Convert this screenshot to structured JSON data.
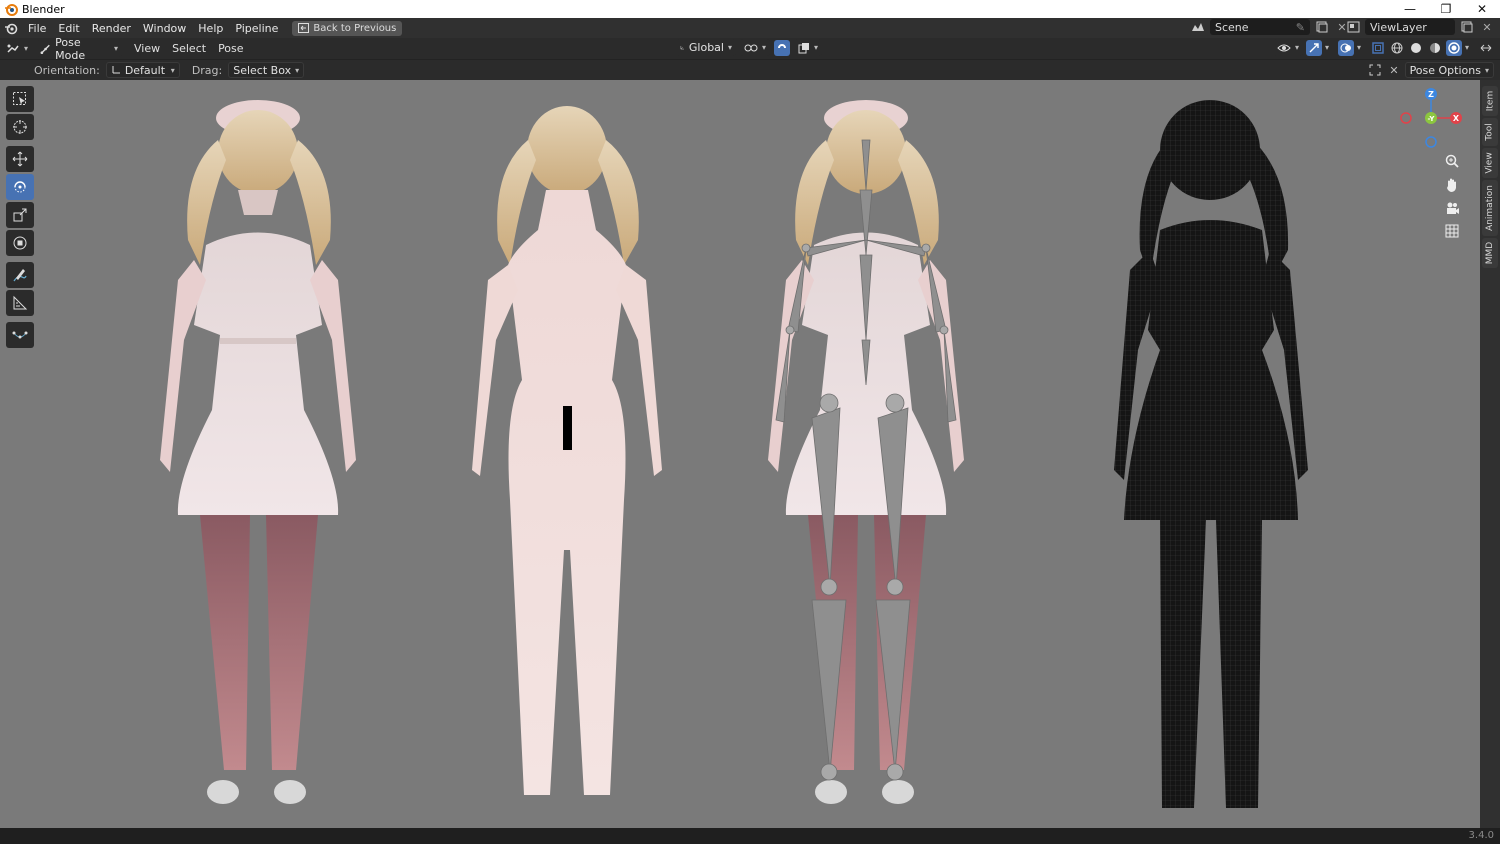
{
  "window": {
    "title": "Blender",
    "controls": [
      "minimize",
      "restore",
      "close"
    ]
  },
  "topbar": {
    "menus": [
      "File",
      "Edit",
      "Render",
      "Window",
      "Help",
      "Pipeline"
    ],
    "back_button": "Back to Previous",
    "scene_name": "Scene",
    "view_layer": "ViewLayer"
  },
  "viewport_header": {
    "mode": "Pose Mode",
    "menus": [
      "View",
      "Select",
      "Pose"
    ],
    "transform_orientation": "Global"
  },
  "tool_settings": {
    "orientation_label": "Orientation:",
    "orientation_value": "Default",
    "drag_label": "Drag:",
    "drag_value": "Select Box",
    "pose_options": "Pose Options"
  },
  "gizmo": {
    "z_label": "Z",
    "y_label": "-Y",
    "x_label": "X"
  },
  "sidebar_tabs": [
    "Item",
    "Tool",
    "View",
    "Animation",
    "MMD"
  ],
  "statusbar": {
    "version": "3.4.0"
  },
  "colors": {
    "accent": "#4772b3",
    "viewport_bg": "#7a7a7a",
    "axis_x": "#e0434a",
    "axis_y": "#8cc63f",
    "axis_z": "#3d87e0"
  }
}
